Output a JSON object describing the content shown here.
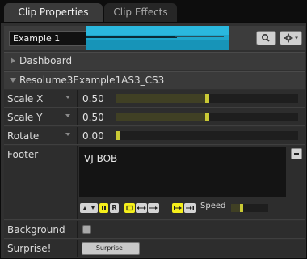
{
  "tabs": [
    {
      "label": "Clip Properties",
      "active": true
    },
    {
      "label": "Clip Effects",
      "active": false
    }
  ],
  "clip": {
    "name_value": "Example 1",
    "thumbnail_color": "#1fa7cc"
  },
  "toolbar": {
    "search_icon": "search-icon",
    "gear_icon": "gear-icon"
  },
  "sections": {
    "dashboard": {
      "label": "Dashboard",
      "expanded": false
    },
    "source": {
      "label": "Resolume3Example1AS3_CS3",
      "expanded": true
    }
  },
  "params": [
    {
      "label": "Scale X",
      "value": "0.50",
      "level": 0.5,
      "has_dropdown": true
    },
    {
      "label": "Scale Y",
      "value": "0.50",
      "level": 0.5,
      "has_dropdown": true
    },
    {
      "label": "Rotate",
      "value": "0.00",
      "level": 0.0,
      "has_dropdown": true
    }
  ],
  "footer": {
    "label": "Footer",
    "text": "VJ BOB",
    "transport": {
      "reverse_label": "R",
      "speed_label": "Speed",
      "speed_level": 0.25
    }
  },
  "background": {
    "label": "Background",
    "checked": false
  },
  "surprise": {
    "label": "Surprise!",
    "button_label": "Surprise!"
  },
  "colors": {
    "accent_yellow": "#f5ef1b",
    "slider_handle": "#c9c935",
    "panel_bg": "#303030"
  }
}
